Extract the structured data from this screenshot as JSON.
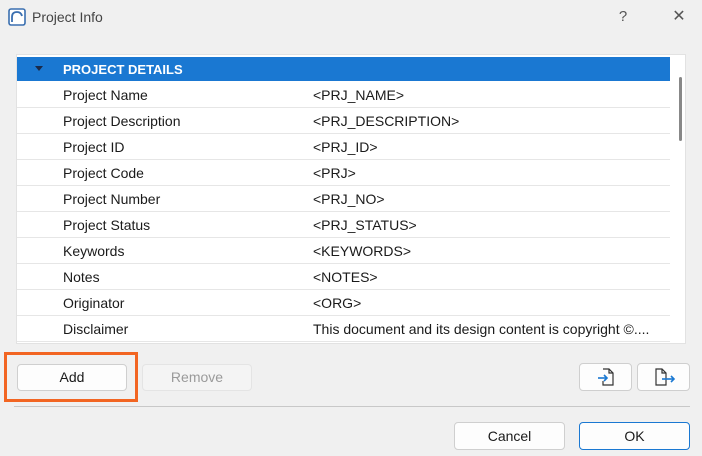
{
  "window": {
    "title": "Project Info",
    "help_label": "?",
    "close_label": "✕"
  },
  "property_list": {
    "group_label": "PROJECT DETAILS",
    "rows": [
      {
        "name": "Project Name",
        "value": "<PRJ_NAME>"
      },
      {
        "name": "Project Description",
        "value": "<PRJ_DESCRIPTION>"
      },
      {
        "name": "Project ID",
        "value": "<PRJ_ID>"
      },
      {
        "name": "Project Code",
        "value": "<PRJ>"
      },
      {
        "name": "Project Number",
        "value": "<PRJ_NO>"
      },
      {
        "name": "Project Status",
        "value": "<PRJ_STATUS>"
      },
      {
        "name": "Keywords",
        "value": "<KEYWORDS>"
      },
      {
        "name": "Notes",
        "value": "<NOTES>"
      },
      {
        "name": "Originator",
        "value": "<ORG>"
      },
      {
        "name": "Disclaimer",
        "value": "This document and its design content is copyright ©...."
      }
    ]
  },
  "buttons": {
    "add": "Add",
    "remove": "Remove",
    "cancel": "Cancel",
    "ok": "OK"
  },
  "icons": {
    "app": "archicad-icon",
    "import": "import-icon",
    "export": "export-icon"
  },
  "colors": {
    "header_blue": "#1a78d2",
    "highlight_orange": "#f26522"
  }
}
